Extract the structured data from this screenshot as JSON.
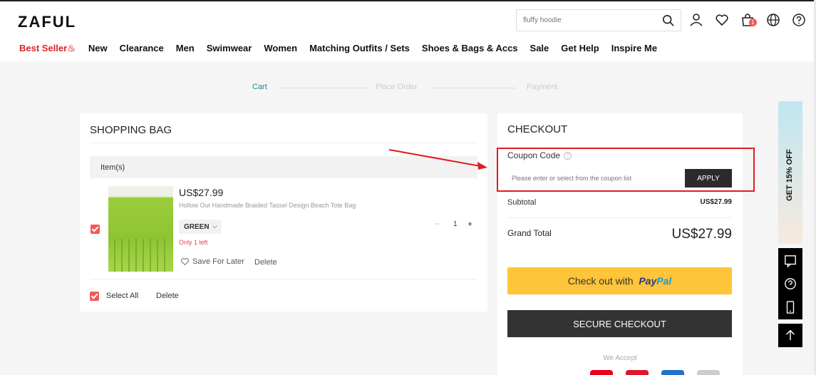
{
  "header": {
    "logo": "ZAFUL",
    "search_placeholder": "fluffy hoodie",
    "cart_count": "1"
  },
  "nav": {
    "best_seller": "Best Seller",
    "items": [
      "New",
      "Clearance",
      "Men",
      "Swimwear",
      "Women",
      "Matching Outfits / Sets",
      "Shoes & Bags & Accs",
      "Sale",
      "Get Help",
      "Inspire Me"
    ]
  },
  "steps": {
    "cart": "Cart",
    "place_order": "Place Order",
    "payment": "Payment"
  },
  "bag": {
    "title": "SHOPPING BAG",
    "items_header": "Item(s)",
    "product": {
      "price": "US$27.99",
      "name": "Hollow Out Handmade Braided Tassel Design Beach Tote Bag",
      "color": "GREEN",
      "stock_note": "Only 1 left",
      "save_later": "Save For Later",
      "delete": "Delete",
      "quantity": "1"
    },
    "select_all": "Select All",
    "delete_all": "Delete"
  },
  "checkout": {
    "title": "CHECKOUT",
    "coupon_label": "Coupon Code",
    "coupon_placeholder": "Please enter or select from the coupon list",
    "apply": "APPLY",
    "subtotal_label": "Subtotal",
    "subtotal_value": "US$27.99",
    "grand_total_label": "Grand Total",
    "grand_total_value": "US$27.99",
    "paypal_prefix": "Check out with",
    "paypal_pay": "Pay",
    "paypal_pal": "Pal",
    "secure": "SECURE CHECKOUT",
    "we_accept": "We Accept"
  },
  "side": {
    "promo": "GET 15% OFF"
  },
  "colors": {
    "accent_red": "#f25a5a",
    "active_step": "#1a8b8b",
    "paypal_yellow": "#fec43a",
    "annotation_red": "#e11b22"
  }
}
